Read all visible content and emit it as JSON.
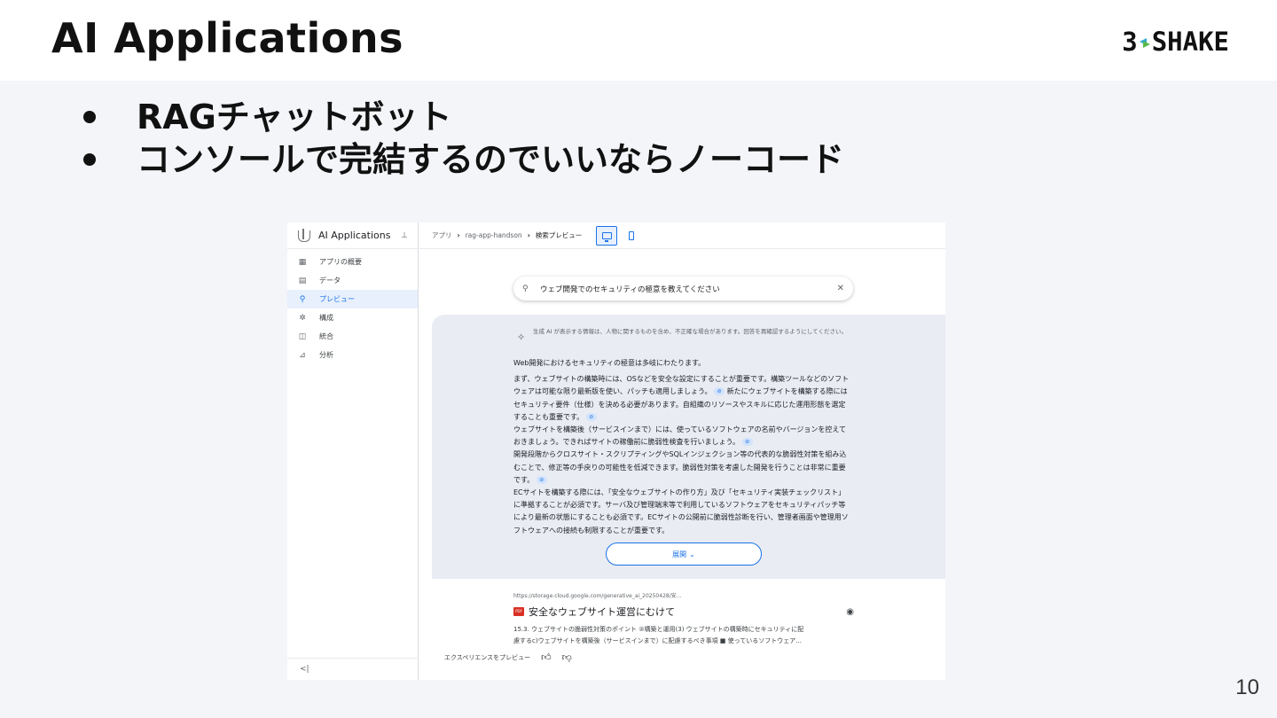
{
  "slide": {
    "title": "AI Applications",
    "logo": {
      "left": "3",
      "right": "SHAKE"
    },
    "bullets": [
      "RAGチャットボット",
      "コンソールで完結するのでいいならノーコード"
    ],
    "page_number": "10"
  },
  "console": {
    "sidebar": {
      "title": "AI Applications",
      "items": [
        {
          "label": "アプリの概要",
          "icon": "dashboard-icon",
          "active": false
        },
        {
          "label": "データ",
          "icon": "data-icon",
          "active": false
        },
        {
          "label": "プレビュー",
          "icon": "search-icon",
          "active": true
        },
        {
          "label": "構成",
          "icon": "gear-icon",
          "active": false
        },
        {
          "label": "統合",
          "icon": "code-icon",
          "active": false
        },
        {
          "label": "分析",
          "icon": "analytics-icon",
          "active": false
        }
      ],
      "collapse": "<|"
    },
    "breadcrumb": {
      "app": "アプリ",
      "project": "rag-app-handson",
      "current": "検索プレビュー"
    },
    "search": {
      "query": "ウェブ開発でのセキュリティの極意を教えてください"
    },
    "answer": {
      "disclaimer": "生成 AI が表示する情報は、人物に関するものを含め、不正確な場合があります。回答を再確認するようにしてください。",
      "intro": "Web開発におけるセキュリティの極意は多岐にわたります。",
      "p1a": "まず、ウェブサイトの構築時には、OSなどを安全な設定にすることが重要です。構築ツールなどのソフトウェアは可能な限り最新版を使い、パッチも適用しましょう。",
      "p1b": "新たにウェブサイトを構築する際にはセキュリティ要件（仕様）を決める必要があります。自組織のリソースやスキルに応じた運用形態を選定することも重要です。",
      "p1c": "ウェブサイトを構築後（サービスインまで）には、使っているソフトウェアの名前やバージョンを控えておきましょう。できればサイトの稼働前に脆弱性検査を行いましょう。",
      "p2": "開発段階からクロスサイト・スクリプティングやSQLインジェクション等の代表的な脆弱性対策を組み込むことで、修正等の手戻りの可能性を低減できます。脆弱性対策を考慮した開発を行うことは非常に重要です。",
      "p3": "ECサイトを構築する際には、「安全なウェブサイトの作り方」及び「セキュリティ実装チェックリスト」に準拠することが必須です。サーバ及び管理端末等で利用しているソフトウェアをセキュリティパッチ等により最新の状態にすることも必須です。ECサイトの公開前に脆弱性診断を行い、管理者画面や管理用ソフトウェアへの接続も制限することが重要です。",
      "expand_label": "展開"
    },
    "result": {
      "url": "https://storage.cloud.google.com/generative_ai_20250428/安...",
      "file_type": "PDF",
      "title": "安全なウェブサイト運営にむけて",
      "snippet_1": "15.3. ウェブサイトの脆弱性対策のポイント ②構築と運用(3) ウェブサイトの構築時にセキュリティに配",
      "snippet_2": "慮するc)ウェブサイトを構築後（サービスインまで）に配慮するべき事項 ■ 使っているソフトウェア..."
    },
    "footer": {
      "label": "エクスペリエンスをプレビュー"
    }
  }
}
